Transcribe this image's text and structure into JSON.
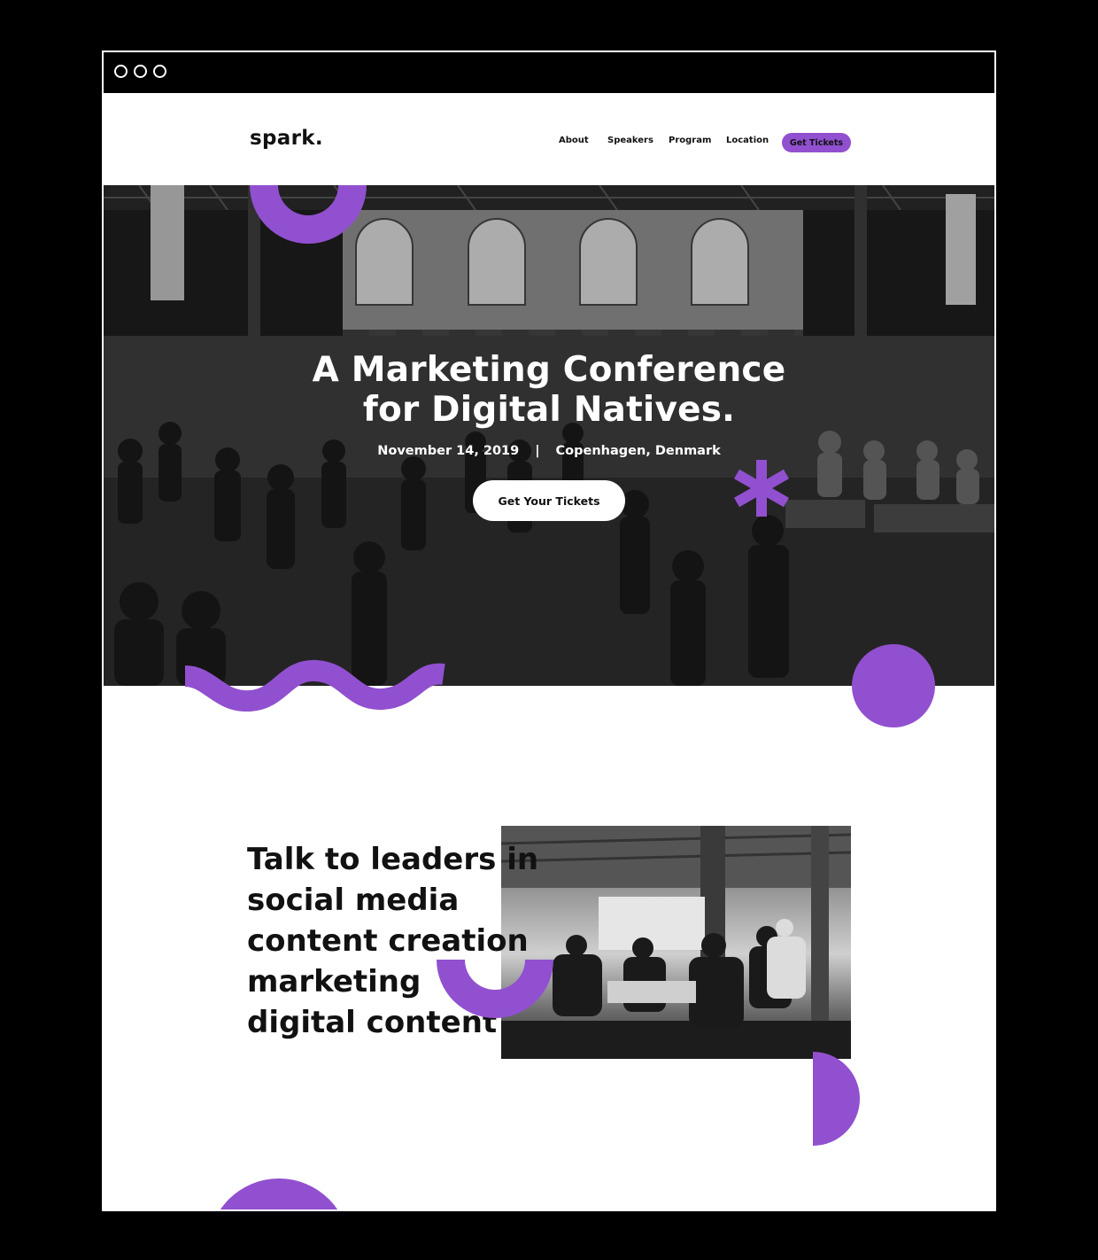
{
  "browser": {
    "window_controls": [
      "dot",
      "dot",
      "dot"
    ]
  },
  "nav": {
    "logo": "spark.",
    "links": [
      "About",
      "Speakers",
      "Program",
      "Location"
    ],
    "cta": "Get Tickets"
  },
  "hero": {
    "title_line1": "A Marketing Conference",
    "title_line2": "for Digital Natives.",
    "date": "November 14, 2019",
    "separator": "|",
    "location": "Copenhagen, Denmark",
    "button": "Get Your Tickets"
  },
  "feature": {
    "lines": [
      "Talk to leaders in",
      "social media",
      "content creation",
      "marketing",
      "digital content"
    ]
  },
  "colors": {
    "accent": "#9150cf",
    "text": "#111111",
    "background": "#ffffff",
    "frame": "#000000"
  }
}
